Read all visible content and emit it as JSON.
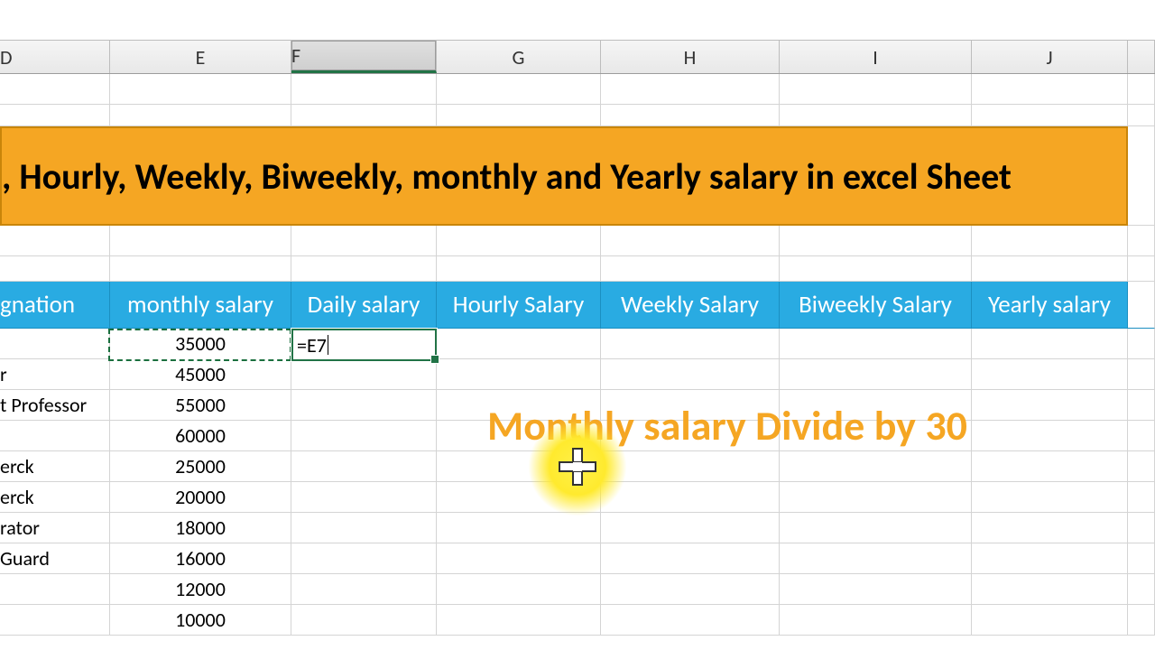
{
  "columns": {
    "D": "D",
    "E": "E",
    "F": "F",
    "G": "G",
    "H": "H",
    "I": "I",
    "J": "J"
  },
  "selected_column": "F",
  "title_banner": ", Hourly, Weekly, Biweekly, monthly and Yearly salary in excel Sheet",
  "table_headers": {
    "D": "gnation",
    "E": "monthly salary",
    "F": "Daily salary",
    "G": "Hourly Salary",
    "H": "Weekly Salary",
    "I": "Biweekly Salary",
    "J": "Yearly salary"
  },
  "rows": [
    {
      "designation": "",
      "monthly": "35000"
    },
    {
      "designation": "r",
      "monthly": "45000"
    },
    {
      "designation": "t Professor",
      "monthly": "55000"
    },
    {
      "designation": "",
      "monthly": "60000"
    },
    {
      "designation": "erck",
      "monthly": "25000"
    },
    {
      "designation": "erck",
      "monthly": "20000"
    },
    {
      "designation": "rator",
      "monthly": "18000"
    },
    {
      "designation": "Guard",
      "monthly": "16000"
    },
    {
      "designation": "",
      "monthly": "12000"
    },
    {
      "designation": "",
      "monthly": "10000"
    }
  ],
  "editing_cell": {
    "address": "F7",
    "formula": "=E7"
  },
  "copy_source_cell": "E7",
  "annotation": "Monthly salary Divide by 30",
  "cursor_icon": "excel-cross-cursor",
  "chart_data": {
    "type": "table",
    "columns": [
      "Designation (partial)",
      "monthly salary",
      "Daily salary",
      "Hourly Salary",
      "Weekly Salary",
      "Biweekly Salary",
      "Yearly salary"
    ],
    "rows": [
      [
        "",
        35000,
        "=E7",
        null,
        null,
        null,
        null
      ],
      [
        "r",
        45000,
        null,
        null,
        null,
        null,
        null
      ],
      [
        "t Professor",
        55000,
        null,
        null,
        null,
        null,
        null
      ],
      [
        "",
        60000,
        null,
        null,
        null,
        null,
        null
      ],
      [
        "erck",
        25000,
        null,
        null,
        null,
        null,
        null
      ],
      [
        "erck",
        20000,
        null,
        null,
        null,
        null,
        null
      ],
      [
        "rator",
        18000,
        null,
        null,
        null,
        null,
        null
      ],
      [
        "Guard",
        16000,
        null,
        null,
        null,
        null,
        null
      ],
      [
        "",
        12000,
        null,
        null,
        null,
        null,
        null
      ],
      [
        "",
        10000,
        null,
        null,
        null,
        null,
        null
      ]
    ]
  }
}
